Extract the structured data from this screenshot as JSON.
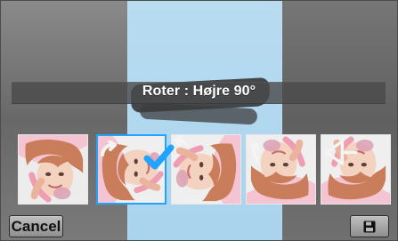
{
  "dialog": {
    "title": "Roter : Højre 90°"
  },
  "filmstrip": {
    "items": [
      {
        "name": "original",
        "selected": false
      },
      {
        "name": "rotate-right-90",
        "selected": true
      },
      {
        "name": "rotate-left-90",
        "selected": false
      },
      {
        "name": "rotate-180",
        "selected": false
      },
      {
        "name": "mirror",
        "selected": false
      }
    ]
  },
  "buttons": {
    "cancel": "Cancel",
    "save_icon": "save-icon"
  },
  "colors": {
    "selection": "#21a4ff",
    "preview_panel": "#b8dcf0",
    "title_bar": "#4a4a4a"
  }
}
